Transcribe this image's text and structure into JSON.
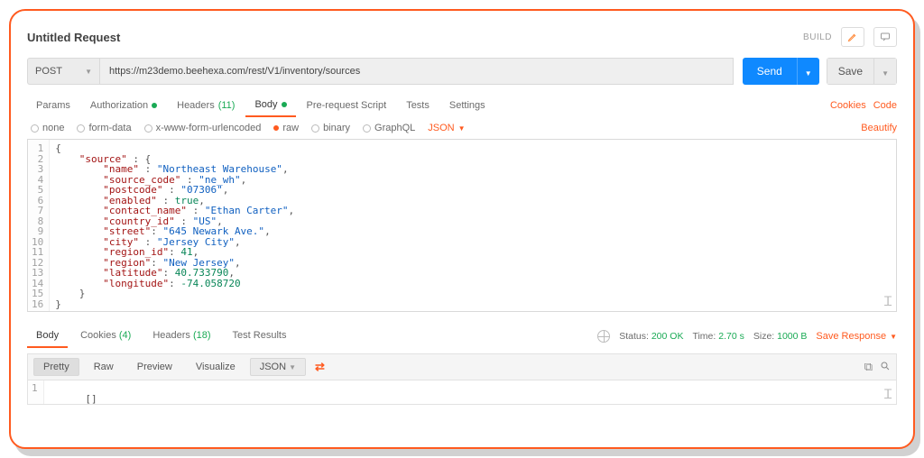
{
  "title": "Untitled Request",
  "build_label": "BUILD",
  "request": {
    "method": "POST",
    "url": "https://m23demo.beehexa.com/rest/V1/inventory/sources",
    "send": "Send",
    "save": "Save"
  },
  "tabs": {
    "params": "Params",
    "auth": "Authorization",
    "headers": "Headers",
    "headers_count": "(11)",
    "body": "Body",
    "prereq": "Pre-request Script",
    "tests": "Tests",
    "settings": "Settings",
    "cookies": "Cookies",
    "code": "Code"
  },
  "body_types": {
    "none": "none",
    "formdata": "form-data",
    "xwww": "x-www-form-urlencoded",
    "raw": "raw",
    "binary": "binary",
    "graphql": "GraphQL",
    "json": "JSON",
    "beautify": "Beautify"
  },
  "editor_lines": [
    "1",
    "2",
    "3",
    "4",
    "5",
    "6",
    "7",
    "8",
    "9",
    "10",
    "11",
    "12",
    "13",
    "14",
    "15",
    "16"
  ],
  "json_payload": {
    "l1": "{",
    "l2_k": "\"source\"",
    "l2_p": " : {",
    "l3_k": "\"name\"",
    "l3_p": " : ",
    "l3_v": "\"Northeast Warehouse\"",
    "l3_e": ",",
    "l4_k": "\"source_code\"",
    "l4_p": " : ",
    "l4_v": "\"ne_wh\"",
    "l4_e": ",",
    "l5_k": "\"postcode\"",
    "l5_p": " : ",
    "l5_v": "\"07306\"",
    "l5_e": ",",
    "l6_k": "\"enabled\"",
    "l6_p": " : ",
    "l6_v": "true",
    "l6_e": ",",
    "l7_k": "\"contact_name\"",
    "l7_p": " : ",
    "l7_v": "\"Ethan Carter\"",
    "l7_e": ",",
    "l8_k": "\"country_id\"",
    "l8_p": " : ",
    "l8_v": "\"US\"",
    "l8_e": ",",
    "l9_k": "\"street\"",
    "l9_p": ": ",
    "l9_v": "\"645 Newark Ave.\"",
    "l9_e": ",",
    "l10_k": "\"city\"",
    "l10_p": " : ",
    "l10_v": "\"Jersey City\"",
    "l10_e": ",",
    "l11_k": "\"region_id\"",
    "l11_p": ": ",
    "l11_v": "41",
    "l11_e": ",",
    "l12_k": "\"region\"",
    "l12_p": ": ",
    "l12_v": "\"New Jersey\"",
    "l12_e": ",",
    "l13_k": "\"latitude\"",
    "l13_p": ": ",
    "l13_v": "40.733790",
    "l13_e": ",",
    "l14_k": "\"longitude\"",
    "l14_p": ": ",
    "l14_v": "-74.058720",
    "l15": "    }",
    "l16": "}"
  },
  "response": {
    "tabs": {
      "body": "Body",
      "cookies": "Cookies",
      "cookies_count": "(4)",
      "headers": "Headers",
      "headers_count": "(18)",
      "tests": "Test Results"
    },
    "status_label": "Status:",
    "status_value": "200 OK",
    "time_label": "Time:",
    "time_value": "2.70 s",
    "size_label": "Size:",
    "size_value": "1000 B",
    "save": "Save Response",
    "toolbar": {
      "pretty": "Pretty",
      "raw": "Raw",
      "preview": "Preview",
      "visualize": "Visualize",
      "json": "JSON"
    },
    "body_lines": [
      "1"
    ],
    "body_text": "[]"
  }
}
